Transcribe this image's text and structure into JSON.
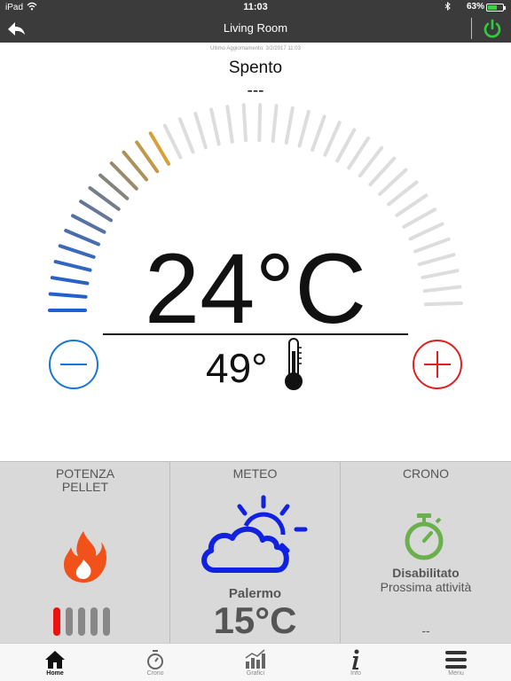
{
  "status_bar": {
    "device": "iPad",
    "time": "11:03",
    "battery": "63%",
    "battery_level": 0.63
  },
  "header": {
    "title": "Living Room"
  },
  "last_update": "Ultimo Aggiornamento: 3/2/2017 11:03",
  "state": "Spento",
  "state_detail": "---",
  "setpoint": "24°C",
  "dial": {
    "ticks_total": 40,
    "ticks_active": 14,
    "cold_color": "#1f5fd1",
    "warm_color": "#d8a037",
    "inactive_color": "#dddddd"
  },
  "room_temp": "49°",
  "colors": {
    "minus": "#1976d2",
    "plus": "#e02020",
    "power": "#2ecc40",
    "flame": "#f0521a",
    "weather": "#1022e0",
    "timer": "#6ab04c",
    "bar_active": "#ee1111",
    "bar_inactive": "#888888"
  },
  "panels": {
    "potenza": {
      "title": "POTENZA PELLET",
      "level": 1,
      "levels": 5
    },
    "meteo": {
      "title": "METEO",
      "city": "Palermo",
      "temp": "15°C"
    },
    "crono": {
      "title": "CRONO",
      "status": "Disabilitato",
      "next": "Prossima attività",
      "next_value": "--"
    }
  },
  "tabs": [
    {
      "label": "Home",
      "icon": "home-icon"
    },
    {
      "label": "Crono",
      "icon": "stopwatch-icon"
    },
    {
      "label": "Grafici",
      "icon": "chart-icon"
    },
    {
      "label": "Info",
      "icon": "info-icon"
    },
    {
      "label": "Menu",
      "icon": "menu-icon"
    }
  ]
}
